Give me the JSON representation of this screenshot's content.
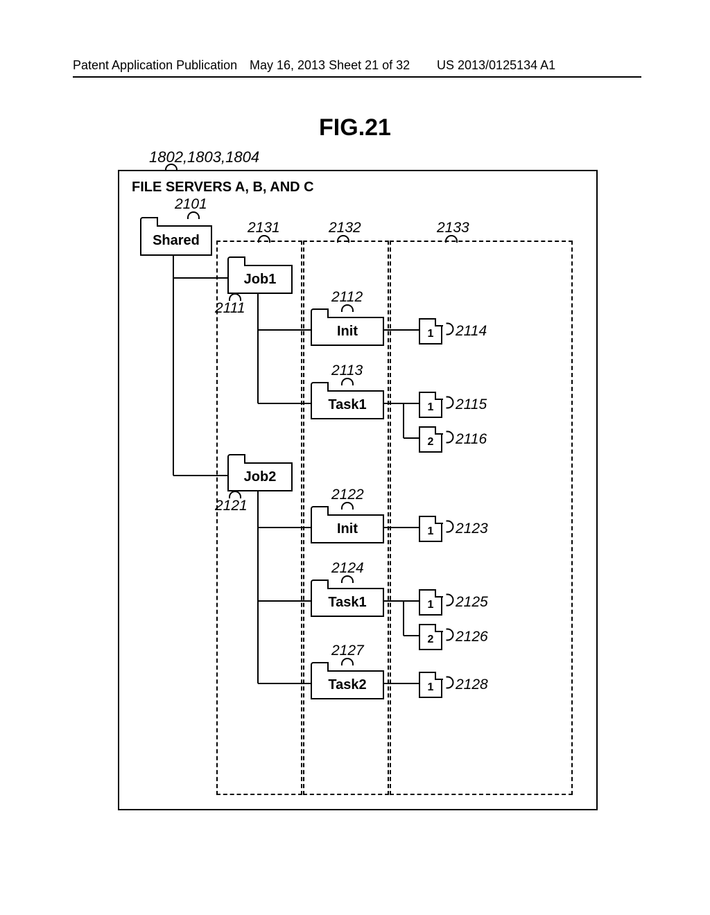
{
  "header": {
    "left": "Patent Application Publication",
    "center": "May 16, 2013  Sheet 21 of 32",
    "right": "US 2013/0125134 A1"
  },
  "figure": {
    "title": "FIG.21",
    "outer_ref": "1802,1803,1804",
    "box_title": "FILE SERVERS A, B, AND C"
  },
  "folders": {
    "shared": {
      "label": "Shared",
      "ref": "2101"
    },
    "job1": {
      "label": "Job1",
      "ref": "2111"
    },
    "job2": {
      "label": "Job2",
      "ref": "2121"
    },
    "j1_init": {
      "label": "Init",
      "ref": "2112"
    },
    "j1_task1": {
      "label": "Task1",
      "ref": "2113"
    },
    "j2_init": {
      "label": "Init",
      "ref": "2122"
    },
    "j2_task1": {
      "label": "Task1",
      "ref": "2124"
    },
    "j2_task2": {
      "label": "Task2",
      "ref": "2127"
    }
  },
  "files": {
    "f2114": {
      "label": "1",
      "ref": "2114"
    },
    "f2115": {
      "label": "1",
      "ref": "2115"
    },
    "f2116": {
      "label": "2",
      "ref": "2116"
    },
    "f2123": {
      "label": "1",
      "ref": "2123"
    },
    "f2125": {
      "label": "1",
      "ref": "2125"
    },
    "f2126": {
      "label": "2",
      "ref": "2126"
    },
    "f2128": {
      "label": "1",
      "ref": "2128"
    }
  },
  "columns": {
    "c1": "2131",
    "c2": "2132",
    "c3": "2133"
  }
}
